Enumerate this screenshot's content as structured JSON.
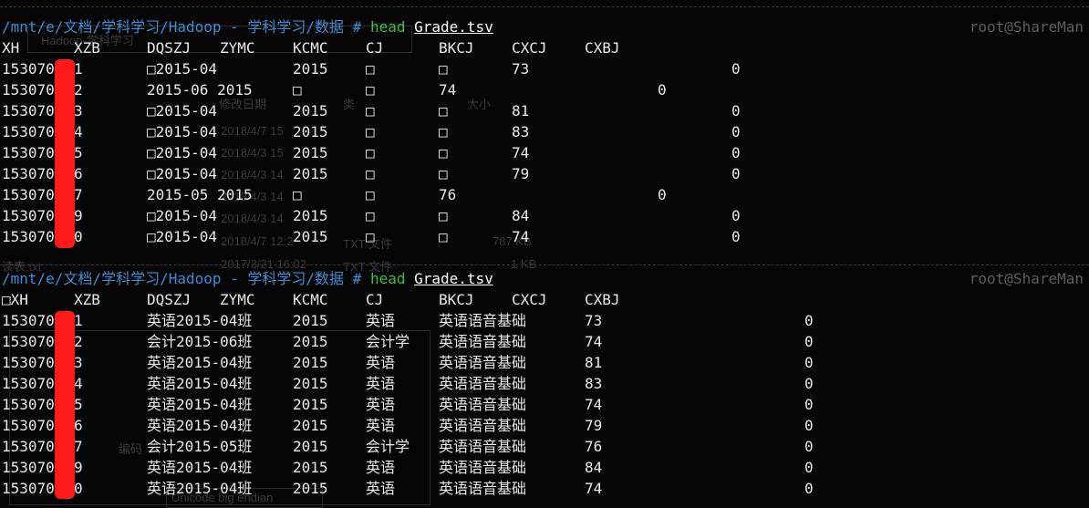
{
  "host_label": "root@ShareMan",
  "prompt": {
    "path": "/mnt/e/文档/学科学习/Hadoop - 学科学习/数据",
    "hash": "#",
    "command": "head",
    "argument": "Grade.tsv"
  },
  "background_window": {
    "labels": [
      "Hadoop-学科学习",
      "修改日期",
      "类",
      "大小",
      "2018/4/7 15",
      "2018/4/3 15",
      "2018/4/3 14",
      "2018/4/3 14",
      "2018/4/3 14",
      "2018/4/7 12:2",
      "TXT 文件",
      "2017/3/21 16:02",
      "TXT 文件",
      "编码",
      "Unicode big endian",
      "读表.txt",
      "1 KB",
      "787 KB"
    ]
  },
  "block1": {
    "header": [
      "XH",
      "XZB",
      "DQSZJ",
      "ZYMC",
      "KCMC",
      "CJ",
      "BKCJ",
      "CXCJ",
      "CXBJ"
    ],
    "rows": [
      [
        "153070",
        "1",
        "□2015-04",
        "",
        "2015",
        "□",
        "□",
        "73",
        "0"
      ],
      [
        "153070",
        "2",
        "2015-06 2015",
        "",
        "□",
        "□",
        "74",
        "",
        "0"
      ],
      [
        "153070",
        "3",
        "□2015-04",
        "",
        "2015",
        "□",
        "□",
        "81",
        "0"
      ],
      [
        "153070",
        "4",
        "□2015-04",
        "",
        "2015",
        "□",
        "□",
        "83",
        "0"
      ],
      [
        "153070",
        "5",
        "□2015-04",
        "",
        "2015",
        "□",
        "□",
        "74",
        "0"
      ],
      [
        "153070",
        "6",
        "□2015-04",
        "",
        "2015",
        "□",
        "□",
        "79",
        "0"
      ],
      [
        "153070",
        "7",
        "2015-05 2015",
        "",
        "□",
        "□",
        "76",
        "",
        "0"
      ],
      [
        "153070",
        "9",
        "□2015-04",
        "",
        "2015",
        "□",
        "□",
        "84",
        "0"
      ],
      [
        "153070",
        "0",
        "□2015-04",
        "",
        "2015",
        "□",
        "□",
        "74",
        "0"
      ]
    ]
  },
  "block2": {
    "header": [
      "□XH",
      "XZB",
      "DQSZJ",
      "ZYMC",
      "KCMC",
      "CJ",
      "BKCJ",
      "CXCJ",
      "CXBJ"
    ],
    "rows": [
      [
        "153070",
        "1",
        "英语2015-04班",
        "2015",
        "英语",
        "英语语音基础",
        "73",
        "0"
      ],
      [
        "153070",
        "2",
        "会计2015-06班",
        "2015",
        "会计学",
        "英语语音基础",
        "74",
        "0"
      ],
      [
        "153070",
        "3",
        "英语2015-04班",
        "2015",
        "英语",
        "英语语音基础",
        "81",
        "0"
      ],
      [
        "153070",
        "4",
        "英语2015-04班",
        "2015",
        "英语",
        "英语语音基础",
        "83",
        "0"
      ],
      [
        "153070",
        "5",
        "英语2015-04班",
        "2015",
        "英语",
        "英语语音基础",
        "74",
        "0"
      ],
      [
        "153070",
        "6",
        "英语2015-04班",
        "2015",
        "英语",
        "英语语音基础",
        "79",
        "0"
      ],
      [
        "153070",
        "7",
        "会计2015-05班",
        "2015",
        "会计学",
        "英语语音基础",
        "76",
        "0"
      ],
      [
        "153070",
        "9",
        "英语2015-04班",
        "2015",
        "英语",
        "英语语音基础",
        "84",
        "0"
      ],
      [
        "153070",
        "0",
        "英语2015-04班",
        "2015",
        "英语",
        "英语语音基础",
        "74",
        "0"
      ]
    ]
  },
  "colors": {
    "path": "#3a8fd6",
    "command": "#3fbf3f",
    "redaction": "#ff1a1a"
  }
}
